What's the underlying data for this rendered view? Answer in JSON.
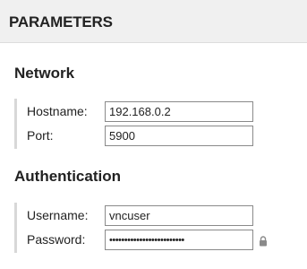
{
  "header": {
    "title": "PARAMETERS"
  },
  "sections": [
    {
      "title": "Network",
      "fields": [
        {
          "label": "Hostname:",
          "value": "192.168.0.2"
        },
        {
          "label": "Port:",
          "value": "5900"
        }
      ]
    },
    {
      "title": "Authentication",
      "fields": [
        {
          "label": "Username:",
          "value": "vncuser"
        },
        {
          "label": "Password:",
          "value": "•••••••••••••••••••••••••"
        }
      ]
    }
  ],
  "icons": {
    "password_lock": "lock-icon"
  }
}
